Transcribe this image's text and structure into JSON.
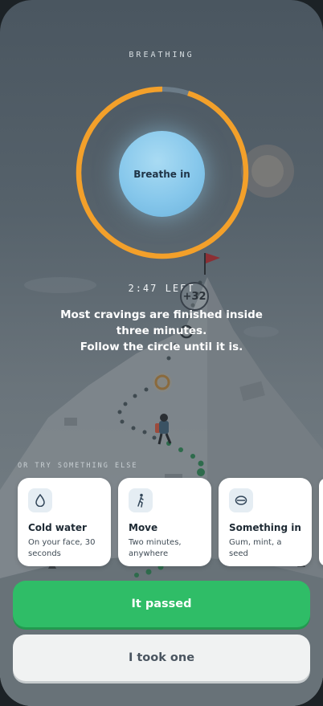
{
  "header": {
    "section_label": "BREATHING"
  },
  "breathing": {
    "instruction": "Breathe in",
    "progress_fraction": 0.95,
    "time_left": "2:47 LEFT",
    "bonus_badge": "+32"
  },
  "message": {
    "line1": "Most cravings are finished inside three minutes.",
    "line2": "Follow the circle until it is."
  },
  "alternatives": {
    "label": "OR TRY SOMETHING ELSE",
    "cards": [
      {
        "icon": "water-drop-icon",
        "title": "Cold water",
        "subtitle": "On your face, 30 seconds"
      },
      {
        "icon": "walking-person-icon",
        "title": "Move",
        "subtitle": "Two minutes, anywhere"
      },
      {
        "icon": "gum-icon",
        "title": "Something in",
        "subtitle": "Gum, mint, a seed"
      }
    ]
  },
  "actions": {
    "primary_label": "It passed",
    "secondary_label": "I took one"
  },
  "colors": {
    "ring": "#f3a02a",
    "primary": "#2fbd67",
    "breathe_circle": "#86c7eb"
  }
}
